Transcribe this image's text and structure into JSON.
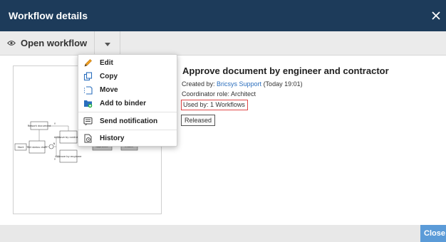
{
  "dialog": {
    "title": "Workflow details"
  },
  "toolbar": {
    "open_label": "Open workflow"
  },
  "menu": {
    "items": [
      {
        "label": "Edit",
        "icon": "pencil-icon"
      },
      {
        "label": "Copy",
        "icon": "copy-icon"
      },
      {
        "label": "Move",
        "icon": "move-icon"
      },
      {
        "label": "Add to binder",
        "icon": "binder-icon"
      },
      {
        "label": "Send notification",
        "icon": "message-icon"
      },
      {
        "label": "History",
        "icon": "history-icon"
      }
    ]
  },
  "workflow": {
    "title": "Approve document by engineer and contractor",
    "created_prefix": "Created by: ",
    "created_by": "Bricsys Support",
    "created_suffix": " (Today 19:01)",
    "coordinator": "Coordinator role: Architect",
    "used_by": "Used by: 1 Workflows",
    "status": "Released"
  },
  "diagram": {
    "nodes": [
      "Start",
      "Set status draft",
      "Rework document",
      "Approve by contractor",
      "Approve by engineer",
      "approved",
      "Ended"
    ],
    "edge_labels": [
      "Y",
      "N",
      "Y"
    ]
  },
  "footer": {
    "close_label": "Close"
  },
  "colors": {
    "titlebar": "#1d3b5a",
    "accent": "#5b9bd8",
    "link": "#2a6ebd",
    "highlight": "#e04848"
  }
}
